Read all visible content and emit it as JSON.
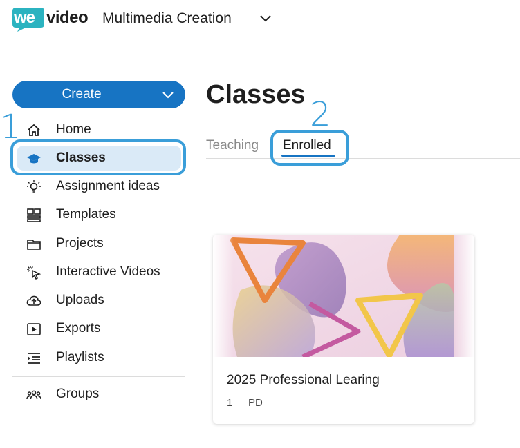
{
  "header": {
    "logo_we": "we",
    "logo_video": "video",
    "workspace": "Multimedia Creation"
  },
  "create": {
    "label": "Create"
  },
  "steps": {
    "one": "1",
    "two": "2"
  },
  "nav": {
    "items": [
      {
        "label": "Home",
        "icon": "home-icon"
      },
      {
        "label": "Classes",
        "icon": "graduation-cap-icon",
        "active": true
      },
      {
        "label": "Assignment ideas",
        "icon": "lightbulb-icon"
      },
      {
        "label": "Templates",
        "icon": "templates-icon"
      },
      {
        "label": "Projects",
        "icon": "folder-icon"
      },
      {
        "label": "Interactive Videos",
        "icon": "cursor-click-icon"
      },
      {
        "label": "Uploads",
        "icon": "cloud-upload-icon"
      },
      {
        "label": "Exports",
        "icon": "play-box-icon"
      },
      {
        "label": "Playlists",
        "icon": "playlist-icon"
      }
    ],
    "groups": {
      "label": "Groups",
      "icon": "groups-icon"
    }
  },
  "main": {
    "title": "Classes",
    "tabs": [
      {
        "label": "Teaching",
        "active": false
      },
      {
        "label": "Enrolled",
        "active": true
      }
    ]
  },
  "card": {
    "title": "2025 Professional Learing",
    "count": "1",
    "code": "PD"
  },
  "colors": {
    "brand_teal": "#2bb3c0",
    "primary_blue": "#1774c3",
    "annotation_blue": "#3a9ed9",
    "active_bg": "#daeaf7"
  }
}
